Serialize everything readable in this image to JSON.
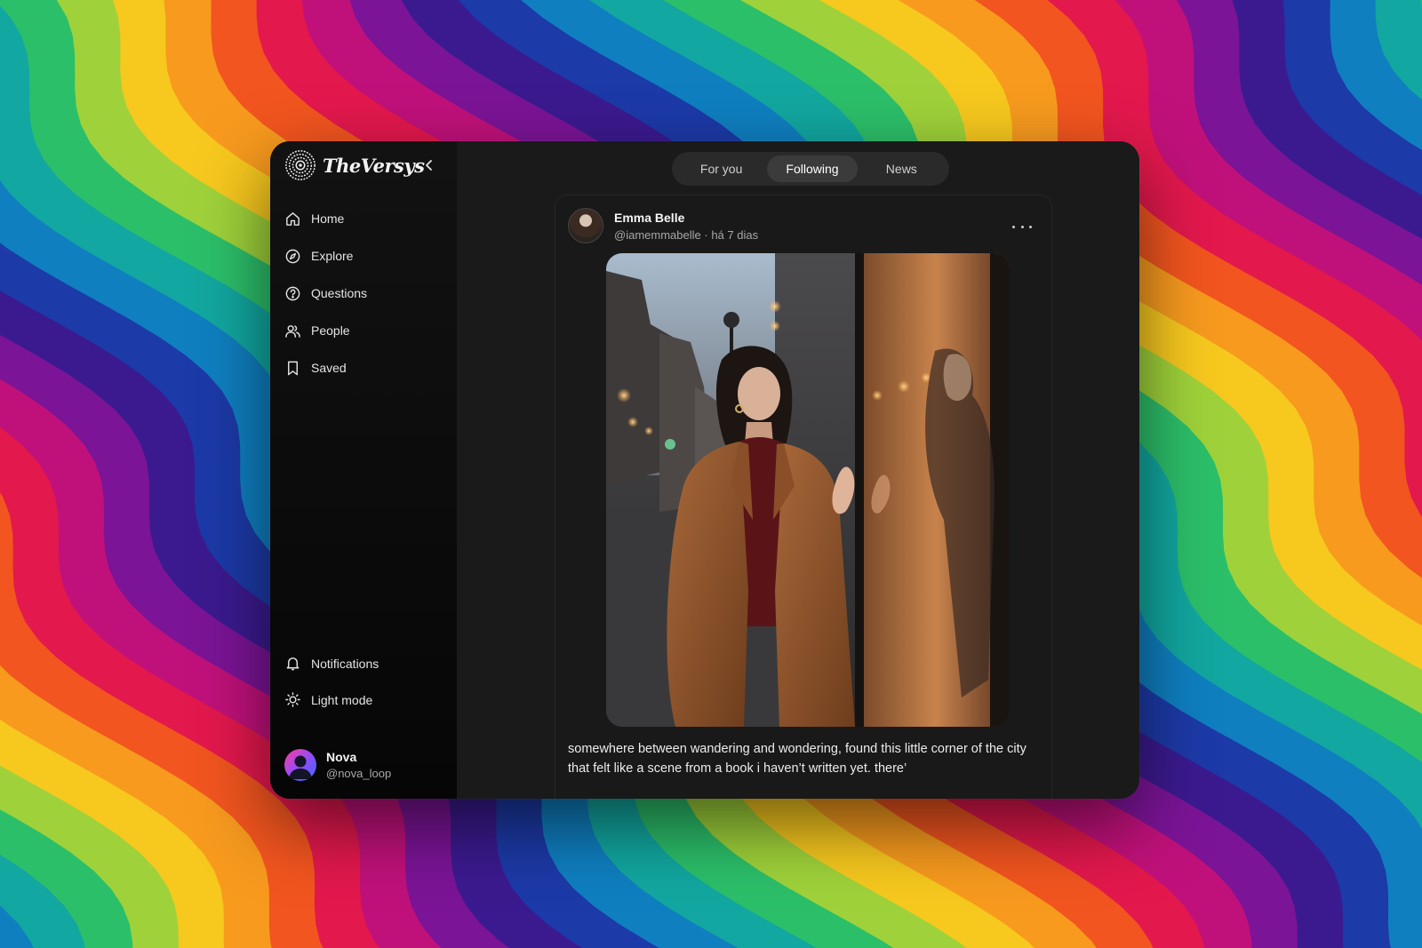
{
  "brand": {
    "name": "TheVersys"
  },
  "sidebar": {
    "items": [
      {
        "label": "Home",
        "icon": "home-icon"
      },
      {
        "label": "Explore",
        "icon": "compass-icon"
      },
      {
        "label": "Questions",
        "icon": "question-icon"
      },
      {
        "label": "People",
        "icon": "people-icon"
      },
      {
        "label": "Saved",
        "icon": "bookmark-icon"
      }
    ],
    "bottom_items": [
      {
        "label": "Notifications",
        "icon": "bell-icon"
      },
      {
        "label": "Light mode",
        "icon": "sun-icon"
      }
    ],
    "user": {
      "name": "Nova",
      "handle": "@nova_loop"
    }
  },
  "feed_tabs": [
    {
      "label": "For you",
      "active": false
    },
    {
      "label": "Following",
      "active": true
    },
    {
      "label": "News",
      "active": false
    }
  ],
  "post": {
    "author_name": "Emma Belle",
    "author_handle": "@iamemmabelle",
    "time": "há 7 dias",
    "meta_separator": "·",
    "caption": "somewhere between wandering and wondering, found this little corner of the city that felt like a scene from a book i haven’t written yet. there’"
  },
  "fab": {
    "symbol": "+"
  }
}
